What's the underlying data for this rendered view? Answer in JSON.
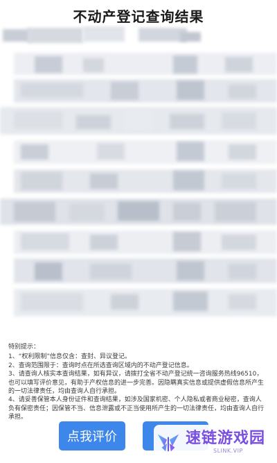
{
  "page": {
    "title": "不动产登记查询结果"
  },
  "notice": {
    "heading": "特别提示：",
    "items": [
      "1、“权利限制”信息仅含：查封、异议登记。",
      "2、查询范围限于：查询时点在所选查询区域内的不动产登记信息。",
      "3、请查询人核实本查询结果，如有异议，请拨打全省不动产登记统一咨询服务热线96510，也可以填写评价意见，有助于产权信息的进一步完善。因隐瞒真实信息或提供虚假信息所产生的一切法律责任，均由查询人自行承担。",
      "4、请妥善保管本人身份证件和查询结果，如涉及国家机密、个人隐私或者商业秘密，查询人负有保密责任；因保管不当、信息泄露或不正当使用所产生的一切法律责任，均由查询人自行承担。"
    ]
  },
  "buttons": {
    "rate_label": "点我评价",
    "second_label": ""
  },
  "watermark": {
    "text": "速链游戏园",
    "sub": "SLINK.VIP",
    "logo_icon": "butterfly-logo-icon",
    "color": "#7a4fe0"
  },
  "colors": {
    "button": "#3d86ea"
  }
}
